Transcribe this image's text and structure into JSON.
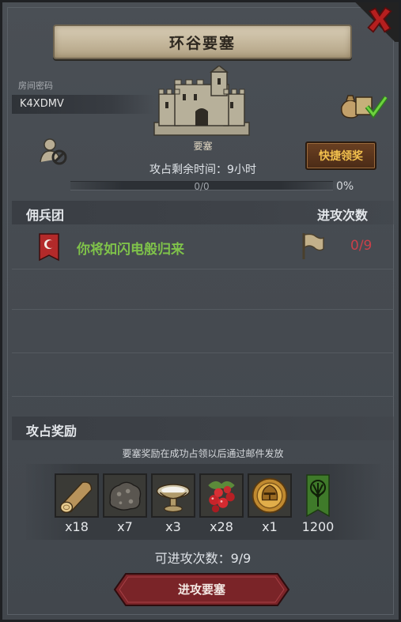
{
  "title": "环谷要塞",
  "room": {
    "label": "房间密码",
    "code": "K4XDMV"
  },
  "fortress": {
    "label": "要塞",
    "icon": "castle-icon"
  },
  "quick_claim_label": "快捷领奖",
  "time_remaining": "攻占剩余时间：9小时",
  "progress": {
    "text": "0/0",
    "percent_text": "0%",
    "fraction": 0
  },
  "mercenary": {
    "header": "佣兵团",
    "attack_header": "进攻次数",
    "rows": [
      {
        "name": "你将如闪电般归来",
        "attacks": "0/9",
        "banner_color": "#b32a2a"
      }
    ]
  },
  "rewards": {
    "header": "攻占奖励",
    "note": "要塞奖励在成功占领以后通过邮件发放",
    "items": [
      {
        "icon": "wood-log-icon",
        "qty": "x18"
      },
      {
        "icon": "ore-stone-icon",
        "qty": "x7"
      },
      {
        "icon": "salt-bowl-icon",
        "qty": "x3"
      },
      {
        "icon": "berries-icon",
        "qty": "x28"
      },
      {
        "icon": "knight-helmet-coin-icon",
        "qty": "x1"
      },
      {
        "icon": "tree-banner-icon",
        "qty": "1200"
      }
    ]
  },
  "attacks_remaining": "可进攻次数：9/9",
  "attack_button_label": "进攻要塞",
  "colors": {
    "accent_green": "#7fc24a",
    "accent_red": "#c9404a",
    "gold": "#f2c04d",
    "button_red": "#7a2428"
  }
}
